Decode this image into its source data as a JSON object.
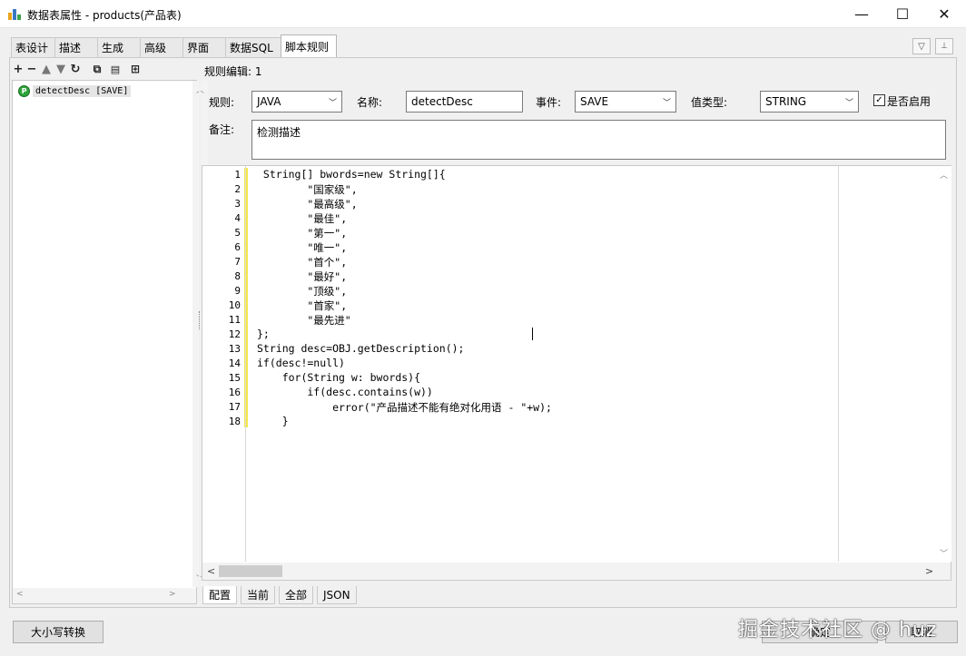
{
  "window": {
    "title": "数据表属性 - products(产品表)",
    "minimize": "—",
    "maximize": "☐",
    "close": "✕"
  },
  "tabs": [
    {
      "label": "表设计"
    },
    {
      "label": "描述"
    },
    {
      "label": "生成"
    },
    {
      "label": "高级"
    },
    {
      "label": "界面"
    },
    {
      "label": "数据SQL"
    },
    {
      "label": "脚本规则"
    }
  ],
  "tab_buttons": {
    "dropdown": "▽",
    "pin": "📌"
  },
  "toolbar": {
    "icons": [
      "plus-icon",
      "minus-icon",
      "arrow-up-icon",
      "arrow-down-icon",
      "refresh-icon",
      "copy-icon",
      "paste-icon",
      "structure-icon"
    ],
    "glyphs": [
      "+",
      "−",
      "🡅",
      "🡇",
      "↻",
      "⧉",
      "📋",
      "⊞"
    ]
  },
  "rule_header": "规则编辑: 1",
  "tree": {
    "items": [
      {
        "badge": "P",
        "label": "detectDesc [SAVE]"
      }
    ]
  },
  "form": {
    "rule_label": "规则:",
    "rule_value": "JAVA",
    "name_label": "名称:",
    "name_value": "detectDesc",
    "event_label": "事件:",
    "event_value": "SAVE",
    "value_type_label": "值类型:",
    "value_type_value": "STRING",
    "enabled_label": "是否启用",
    "enabled_checked": "✓",
    "remark_label": "备注:",
    "remark_value": "检测描述"
  },
  "editor": {
    "line_numbers": [
      "1",
      "2",
      "3",
      "4",
      "5",
      "6",
      "7",
      "8",
      "9",
      "10",
      "11",
      "12",
      "13",
      "14",
      "15",
      "16",
      "17",
      "18"
    ],
    "lines": [
      " String[] bwords=new String[]{",
      "        \"国家级\",",
      "        \"最高级\",",
      "        \"最佳\",",
      "        \"第一\",",
      "        \"唯一\",",
      "        \"首个\",",
      "        \"最好\",",
      "        \"顶级\",",
      "        \"首家\",",
      "        \"最先进\"",
      "};",
      "String desc=OBJ.getDescription();",
      "if(desc!=null)",
      "    for(String w: bwords){",
      "        if(desc.contains(w))",
      "            error(\"产品描述不能有绝对化用语 - \"+w);",
      "    }"
    ]
  },
  "bottom_tabs": [
    "配置",
    "当前",
    "全部",
    "JSON"
  ],
  "buttons": {
    "case_convert": "大小写转换",
    "ok": "确定",
    "cancel": "取消"
  },
  "watermark": "掘金技术社区 @ huz"
}
